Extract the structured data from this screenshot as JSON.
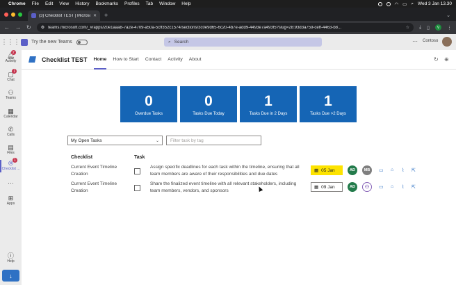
{
  "menubar": {
    "app": "Chrome",
    "items": [
      "File",
      "Edit",
      "View",
      "History",
      "Bookmarks",
      "Profiles",
      "Tab",
      "Window",
      "Help"
    ],
    "clock": "Wed 3 Jan  13.30"
  },
  "browser": {
    "tab_title": "(3) Checklist TEST | Microsoft",
    "url": "teams.microsoft.com/_#/apps/20e1aaa8-7a2e-4709-a50a-5cff352c1574/sections/3c0e9d65-6c20-4b7e-add9-4493e7a493f5?slug=28:93d3a759-ceff-4463-b8..."
  },
  "teams": {
    "try_new": "Try the new Teams",
    "search_placeholder": "Search",
    "org": "Contoso",
    "more": "···"
  },
  "rail": [
    {
      "label": "Activity",
      "badge": "2"
    },
    {
      "label": "Chat",
      "badge": "1"
    },
    {
      "label": "Teams",
      "badge": ""
    },
    {
      "label": "Calendar",
      "badge": ""
    },
    {
      "label": "Calls",
      "badge": ""
    },
    {
      "label": "Files",
      "badge": ""
    },
    {
      "label": "Checklist ...",
      "badge": "1"
    },
    {
      "label": "···",
      "badge": ""
    },
    {
      "label": "Apps",
      "badge": ""
    },
    {
      "label": "Help",
      "badge": ""
    }
  ],
  "app": {
    "title": "Checklist TEST",
    "tabs": [
      "Home",
      "How to Start",
      "Contact",
      "Activity",
      "About"
    ],
    "active_tab": "Home"
  },
  "summary": [
    {
      "value": "0",
      "label": "Overdue Tasks"
    },
    {
      "value": "0",
      "label": "Tasks Due Today"
    },
    {
      "value": "1",
      "label": "Tasks Due in 2 Days"
    },
    {
      "value": "1",
      "label": "Tasks Due >2 Days"
    }
  ],
  "filters": {
    "view": "My Open Tasks",
    "tag_placeholder": "Filter task by tag"
  },
  "table": {
    "headers": {
      "checklist": "Checklist",
      "task": "Task"
    },
    "rows": [
      {
        "checklist": "Current Event Timeline Creation",
        "task": "Assign specific deadlines for each task within the timeline, ensuring that all team members are aware of their responsibilities and due dates",
        "due": "05 Jan",
        "due_highlight": "#fde300",
        "owner": "AD",
        "assignee": "MB"
      },
      {
        "checklist": "Current Event Timeline Creation",
        "task": "Share the finalized event timeline with all relevant stakeholders, including team members, vendors, and sponsors",
        "due": "09 Jan",
        "due_highlight": "",
        "owner": "AD",
        "assignee": ""
      }
    ]
  },
  "colors": {
    "tile_blue": "#1565b5",
    "teams_purple": "#5b5fc7",
    "due_soon": "#fde300",
    "owner_green": "#237b4b"
  }
}
